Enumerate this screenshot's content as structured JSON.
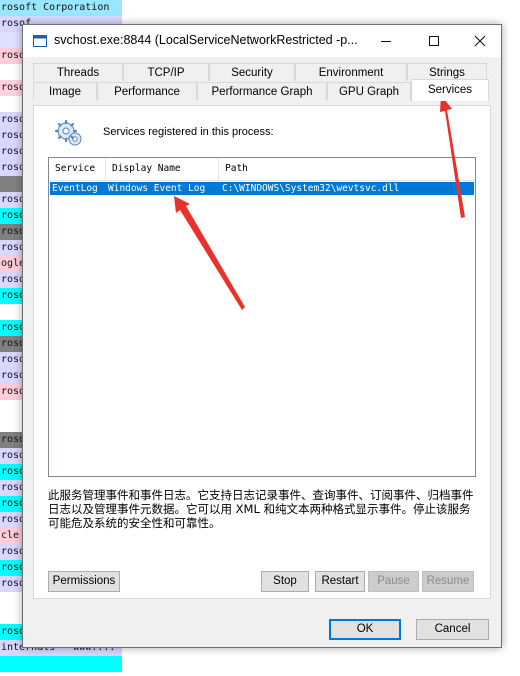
{
  "background_rows": [
    {
      "text": "rosoft Corporation",
      "color": "#99e6ff"
    },
    {
      "text": "rosof",
      "color": "#d7d7ff"
    },
    {
      "text": "",
      "color": "#e0e0ff"
    },
    {
      "text": "rosof",
      "color": "#ffccd9"
    },
    {
      "text": "",
      "color": "#ffffff"
    },
    {
      "text": "rosof",
      "color": "#ffd0e0"
    },
    {
      "text": "",
      "color": "#ffffff"
    },
    {
      "text": "rosof",
      "color": "#d7d7ff"
    },
    {
      "text": "rosof",
      "color": "#d7d7ff"
    },
    {
      "text": "rosof",
      "color": "#d7d7ff"
    },
    {
      "text": "rosof",
      "color": "#d7d7ff"
    },
    {
      "text": "",
      "color": "#808080"
    },
    {
      "text": "rosof",
      "color": "#d7d7ff"
    },
    {
      "text": "rosof",
      "color": "#00ffff"
    },
    {
      "text": "rosof",
      "color": "#808080"
    },
    {
      "text": "rosof",
      "color": "#d7d7ff"
    },
    {
      "text": "ogle",
      "color": "#ffccd9"
    },
    {
      "text": "rosof",
      "color": "#d7d7ff"
    },
    {
      "text": "rosof",
      "color": "#00ffff"
    },
    {
      "text": "",
      "color": "#ffffff"
    },
    {
      "text": "rosof",
      "color": "#00ffff"
    },
    {
      "text": "rosof",
      "color": "#808080"
    },
    {
      "text": "rosof",
      "color": "#d7d7ff"
    },
    {
      "text": "rosof",
      "color": "#d7d7ff"
    },
    {
      "text": "rosof",
      "color": "#ffccd9"
    },
    {
      "text": "",
      "color": "#ffffff"
    },
    {
      "text": "",
      "color": "#ffffff"
    },
    {
      "text": "rosof",
      "color": "#808080"
    },
    {
      "text": "rosof",
      "color": "#d7d7ff"
    },
    {
      "text": "rosof",
      "color": "#00ffff"
    },
    {
      "text": "rosof",
      "color": "#d7d7ff"
    },
    {
      "text": "rosof",
      "color": "#00ffff"
    },
    {
      "text": "rosof",
      "color": "#d7d7ff"
    },
    {
      "text": "cle",
      "color": "#ffccd9"
    },
    {
      "text": "rosof",
      "color": "#d7d7ff"
    },
    {
      "text": "rosof",
      "color": "#00ffff"
    },
    {
      "text": "rosof",
      "color": "#d7d7ff"
    },
    {
      "text": "",
      "color": "#ffffff"
    },
    {
      "text": "",
      "color": "#ffffff"
    },
    {
      "text": "rosof",
      "color": "#00ffff"
    },
    {
      "text": "internals - www....",
      "color": "#d7d7ff"
    },
    {
      "text": "",
      "color": "#00ffff"
    }
  ],
  "window": {
    "title": "svchost.exe:8844 (LocalServiceNetworkRestricted -p...",
    "minimize_icon": "minimize-icon",
    "maximize_icon": "maximize-icon",
    "close_icon": "close-icon"
  },
  "tabs_top": [
    "Threads",
    "TCP/IP",
    "Security",
    "Environment",
    "Strings"
  ],
  "tabs_bottom": [
    "Image",
    "Performance",
    "Performance Graph",
    "GPU Graph",
    "Services"
  ],
  "active_tab": "Services",
  "services": {
    "heading": "Services registered in this process:",
    "icon": "gears-icon",
    "columns": [
      "Service",
      "Display Name",
      "Path"
    ],
    "rows": [
      {
        "service": "EventLog",
        "display_name": "Windows Event Log",
        "path": "C:\\WINDOWS\\System32\\wevtsvc.dll",
        "selected": true
      }
    ],
    "description": "此服务管理事件和事件日志。它支持日志记录事件、查询事件、订阅事件、归档事件日志以及管理事件元数据。它可以用 XML 和纯文本两种格式显示事件。停止该服务可能危及系统的安全性和可靠性。"
  },
  "buttons": {
    "permissions": "Permissions",
    "stop": "Stop",
    "restart": "Restart",
    "pause": "Pause",
    "resume": "Resume",
    "ok": "OK",
    "cancel": "Cancel"
  },
  "colors": {
    "selection": "#0078d7",
    "annotation_arrow": "#e8322b"
  }
}
